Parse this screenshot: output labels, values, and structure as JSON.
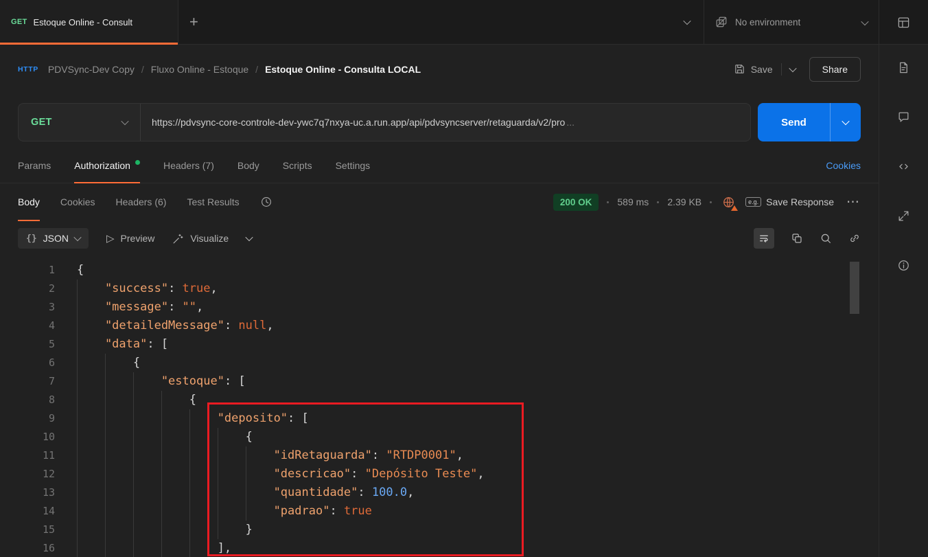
{
  "colors": {
    "accent": "#ff6c37",
    "method_get": "#6bdd9a",
    "send_blue": "#0b72e8",
    "link_blue": "#4a9cf8",
    "status_bg": "#113f24",
    "status_text": "#61cf8d",
    "warn_orange": "#e2662e",
    "annotation": "#ea1b22"
  },
  "icons": {
    "plus": "+",
    "more": "⋯",
    "preview_play": "▷",
    "braces": "{}"
  },
  "topbar": {
    "tab": {
      "method": "GET",
      "title": "Estoque Online - Consult"
    },
    "environment": "No environment"
  },
  "header": {
    "protocol": "HTTP",
    "separator": "/",
    "breadcrumb": [
      "PDVSync-Dev Copy",
      "Fluxo Online - Estoque",
      "Estoque Online - Consulta LOCAL"
    ],
    "save": "Save",
    "share": "Share"
  },
  "request": {
    "method": "GET",
    "url": "https://pdvsync-core-controle-dev-ywc7q7nxya-uc.a.run.app/api/pdvsyncserver/retaguarda/v2/pro",
    "ellipsis": "...",
    "send": "Send"
  },
  "request_tabs": {
    "params": "Params",
    "authorization": "Authorization",
    "headers": "Headers (7)",
    "body": "Body",
    "scripts": "Scripts",
    "settings": "Settings",
    "cookies": "Cookies"
  },
  "response": {
    "tabs": {
      "body": "Body",
      "cookies": "Cookies",
      "headers": "Headers (6)",
      "test_results": "Test Results"
    },
    "status": "200 OK",
    "time": "589 ms",
    "size": "2.39 KB",
    "example_badge": "e.g.",
    "save_response": "Save Response",
    "toolbar": {
      "format": "JSON",
      "preview": "Preview",
      "visualize": "Visualize"
    }
  },
  "code": {
    "lines": [
      {
        "n": 1,
        "ind": 0,
        "t": [
          [
            "p",
            "{"
          ]
        ]
      },
      {
        "n": 2,
        "ind": 1,
        "t": [
          [
            "k",
            "\"success\""
          ],
          [
            "p",
            ": "
          ],
          [
            "b",
            "true"
          ],
          [
            "p",
            ","
          ]
        ]
      },
      {
        "n": 3,
        "ind": 1,
        "t": [
          [
            "k",
            "\"message\""
          ],
          [
            "p",
            ": "
          ],
          [
            "s",
            "\"\""
          ],
          [
            "p",
            ","
          ]
        ]
      },
      {
        "n": 4,
        "ind": 1,
        "t": [
          [
            "k",
            "\"detailedMessage\""
          ],
          [
            "p",
            ": "
          ],
          [
            "b",
            "null"
          ],
          [
            "p",
            ","
          ]
        ]
      },
      {
        "n": 5,
        "ind": 1,
        "t": [
          [
            "k",
            "\"data\""
          ],
          [
            "p",
            ": ["
          ]
        ]
      },
      {
        "n": 6,
        "ind": 2,
        "t": [
          [
            "p",
            "{"
          ]
        ]
      },
      {
        "n": 7,
        "ind": 3,
        "t": [
          [
            "k",
            "\"estoque\""
          ],
          [
            "p",
            ": ["
          ]
        ]
      },
      {
        "n": 8,
        "ind": 4,
        "t": [
          [
            "p",
            "{"
          ]
        ]
      },
      {
        "n": 9,
        "ind": 5,
        "t": [
          [
            "k",
            "\"deposito\""
          ],
          [
            "p",
            ": ["
          ]
        ]
      },
      {
        "n": 10,
        "ind": 6,
        "t": [
          [
            "p",
            "{"
          ]
        ]
      },
      {
        "n": 11,
        "ind": 7,
        "t": [
          [
            "k",
            "\"idRetaguarda\""
          ],
          [
            "p",
            ": "
          ],
          [
            "s",
            "\"RTDP0001\""
          ],
          [
            "p",
            ","
          ]
        ]
      },
      {
        "n": 12,
        "ind": 7,
        "t": [
          [
            "k",
            "\"descricao\""
          ],
          [
            "p",
            ": "
          ],
          [
            "s",
            "\"Depósito Teste\""
          ],
          [
            "p",
            ","
          ]
        ]
      },
      {
        "n": 13,
        "ind": 7,
        "t": [
          [
            "k",
            "\"quantidade\""
          ],
          [
            "p",
            ": "
          ],
          [
            "n",
            "100.0"
          ],
          [
            "p",
            ","
          ]
        ]
      },
      {
        "n": 14,
        "ind": 7,
        "t": [
          [
            "k",
            "\"padrao\""
          ],
          [
            "p",
            ": "
          ],
          [
            "b",
            "true"
          ]
        ]
      },
      {
        "n": 15,
        "ind": 6,
        "t": [
          [
            "p",
            "}"
          ]
        ]
      },
      {
        "n": 16,
        "ind": 5,
        "t": [
          [
            "p",
            "],"
          ]
        ]
      }
    ]
  }
}
